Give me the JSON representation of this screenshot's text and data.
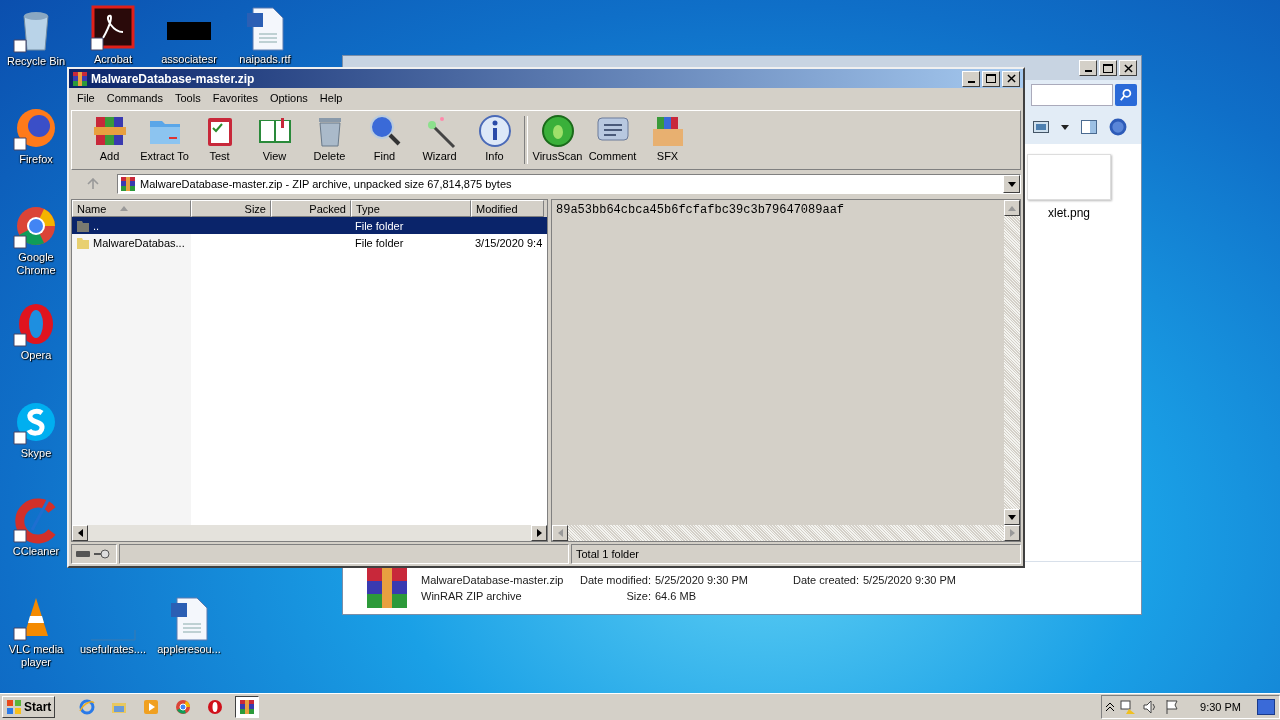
{
  "desktop": {
    "top_row": [
      {
        "label": "Acrobat",
        "kind": "acrobat"
      },
      {
        "label": "associatesr",
        "kind": "black"
      },
      {
        "label": "naipads.rtf",
        "kind": "word"
      }
    ],
    "left_column": [
      {
        "label": "Recycle Bin",
        "kind": "recycle"
      },
      {
        "label": "Firefox",
        "kind": "firefox"
      },
      {
        "label": "Google Chrome",
        "kind": "chrome"
      },
      {
        "label": "Opera",
        "kind": "opera"
      },
      {
        "label": "Skype",
        "kind": "skype"
      },
      {
        "label": "CCleaner",
        "kind": "ccleaner"
      },
      {
        "label": "VLC media player",
        "kind": "vlc"
      }
    ],
    "bottom_row": [
      {
        "label": "usefulrates....",
        "kind": "blank"
      },
      {
        "label": "appleresou...",
        "kind": "word"
      }
    ]
  },
  "explorer": {
    "files": [
      {
        "name": "xlet.png"
      }
    ],
    "details": {
      "name": "MalwareDatabase-master.zip",
      "type": "WinRAR ZIP archive",
      "modified_label": "Date modified:",
      "modified": "5/25/2020 9:30 PM",
      "created_label": "Date created:",
      "created": "5/25/2020 9:30 PM",
      "size_label": "Size:",
      "size": "64.6 MB"
    }
  },
  "winrar": {
    "title": "MalwareDatabase-master.zip",
    "menu": [
      "File",
      "Commands",
      "Tools",
      "Favorites",
      "Options",
      "Help"
    ],
    "toolbar": [
      {
        "label": "Add",
        "kind": "add"
      },
      {
        "label": "Extract To",
        "kind": "extract"
      },
      {
        "label": "Test",
        "kind": "test"
      },
      {
        "label": "View",
        "kind": "view"
      },
      {
        "label": "Delete",
        "kind": "delete"
      },
      {
        "label": "Find",
        "kind": "find"
      },
      {
        "label": "Wizard",
        "kind": "wizard"
      },
      {
        "label": "Info",
        "kind": "info"
      },
      {
        "label": "VirusScan",
        "kind": "virus"
      },
      {
        "label": "Comment",
        "kind": "comment"
      },
      {
        "label": "SFX",
        "kind": "sfx"
      }
    ],
    "address": "MalwareDatabase-master.zip - ZIP archive, unpacked size 67,814,875 bytes",
    "columns": [
      {
        "label": "Name",
        "sorted": true
      },
      {
        "label": "Size",
        "sorted": false
      },
      {
        "label": "Packed",
        "sorted": false
      },
      {
        "label": "Type",
        "sorted": false
      },
      {
        "label": "Modified",
        "sorted": false
      }
    ],
    "rows": [
      {
        "kind": "up",
        "name": "..",
        "size": "",
        "packed": "",
        "type": "File folder",
        "modified": "",
        "selected": true
      },
      {
        "kind": "folder",
        "name": "MalwareDatabas...",
        "size": "",
        "packed": "",
        "type": "File folder",
        "modified": "3/15/2020 9:4",
        "selected": false
      }
    ],
    "preview": "89a53bb64cbca45b6fcfafbc39c3b79647089aaf",
    "status": "Total 1 folder"
  },
  "taskbar": {
    "start": "Start",
    "tasks": [
      {
        "kind": "ie",
        "selected": false
      },
      {
        "kind": "explorer",
        "selected": false
      },
      {
        "kind": "media",
        "selected": false
      },
      {
        "kind": "chrome",
        "selected": false
      },
      {
        "kind": "opera",
        "selected": false
      },
      {
        "kind": "winrar",
        "selected": true
      }
    ],
    "clock": "9:30 PM"
  }
}
